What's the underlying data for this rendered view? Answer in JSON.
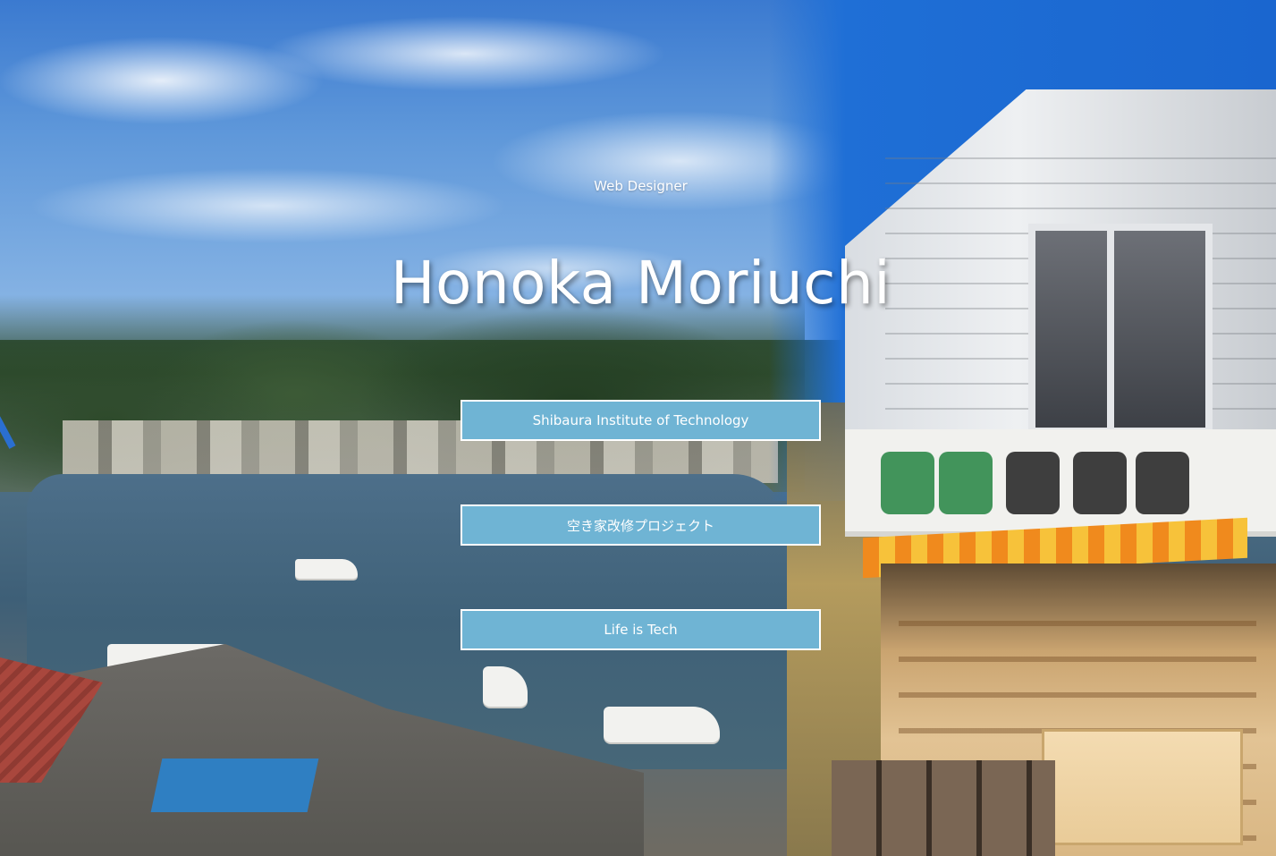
{
  "hero": {
    "role": "Web Designer",
    "name": "Honoka Moriuchi",
    "background_description_icon": "harbor-and-shop-photo"
  },
  "links": [
    {
      "label": "Shibaura Institute of Technology"
    },
    {
      "label": "空き家改修プロジェクト"
    },
    {
      "label": "Life is Tech"
    }
  ],
  "colors": {
    "button_bg": "#6fb4d4",
    "button_border": "#ffffff",
    "text": "#ffffff"
  }
}
